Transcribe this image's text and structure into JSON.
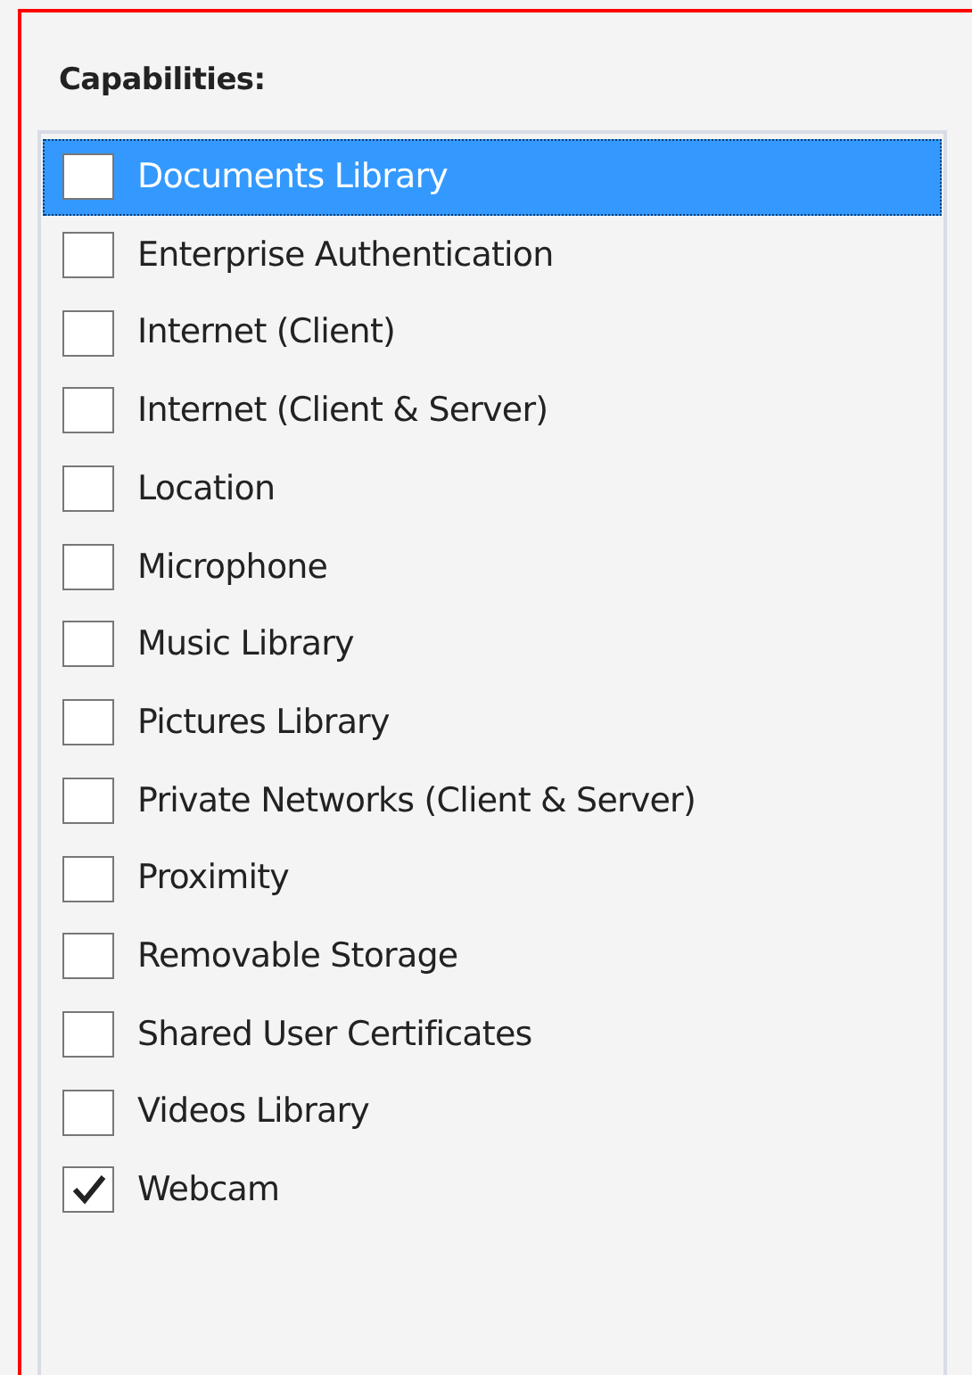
{
  "title": "Capabilities:",
  "capabilities": [
    {
      "label": "Documents Library",
      "checked": false,
      "selected": true
    },
    {
      "label": "Enterprise Authentication",
      "checked": false,
      "selected": false
    },
    {
      "label": "Internet (Client)",
      "checked": false,
      "selected": false
    },
    {
      "label": "Internet (Client & Server)",
      "checked": false,
      "selected": false
    },
    {
      "label": "Location",
      "checked": false,
      "selected": false
    },
    {
      "label": "Microphone",
      "checked": false,
      "selected": false
    },
    {
      "label": "Music Library",
      "checked": false,
      "selected": false
    },
    {
      "label": "Pictures Library",
      "checked": false,
      "selected": false
    },
    {
      "label": "Private Networks (Client & Server)",
      "checked": false,
      "selected": false
    },
    {
      "label": "Proximity",
      "checked": false,
      "selected": false
    },
    {
      "label": "Removable Storage",
      "checked": false,
      "selected": false
    },
    {
      "label": "Shared User Certificates",
      "checked": false,
      "selected": false
    },
    {
      "label": "Videos Library",
      "checked": false,
      "selected": false
    },
    {
      "label": "Webcam",
      "checked": true,
      "selected": false
    }
  ]
}
